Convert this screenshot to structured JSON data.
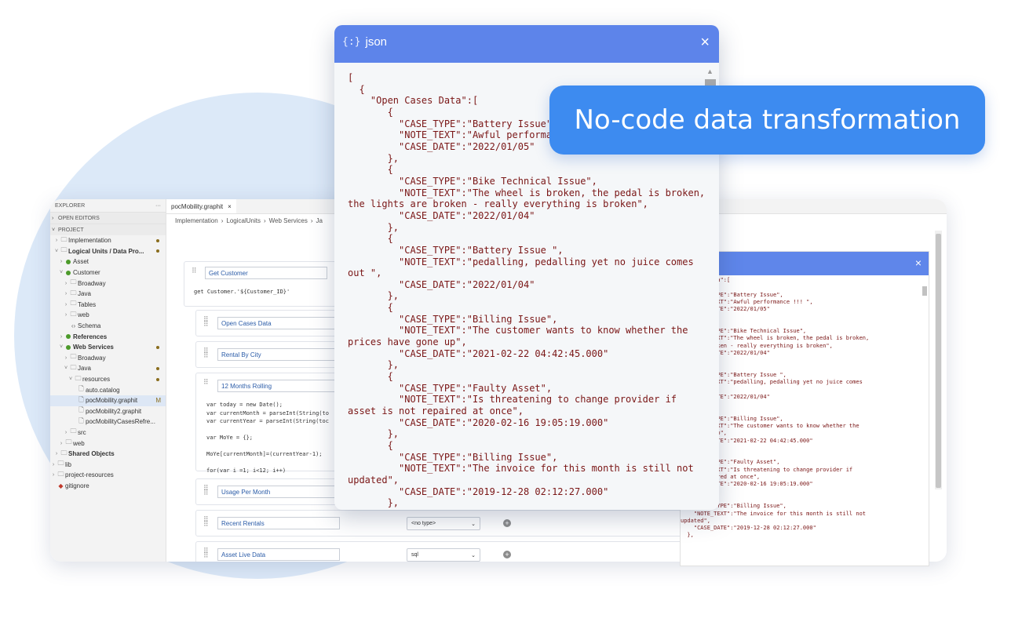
{
  "badge": {
    "text": "No-code data transformation"
  },
  "explorer": {
    "title": "EXPLORER",
    "more": "···",
    "open_editors": "OPEN EDITORS",
    "project": "PROJECT",
    "items": [
      {
        "label": "Implementation"
      },
      {
        "label": "Logical Units / Data Pro..."
      },
      {
        "label": "Asset"
      },
      {
        "label": "Customer"
      },
      {
        "label": "Broadway"
      },
      {
        "label": "Java"
      },
      {
        "label": "Tables"
      },
      {
        "label": "web"
      },
      {
        "label": "Schema"
      },
      {
        "label": "References"
      },
      {
        "label": "Web Services"
      },
      {
        "label": "Broadway"
      },
      {
        "label": "Java"
      },
      {
        "label": "resources"
      },
      {
        "label": "auto.catalog"
      },
      {
        "label": "pocMobility.graphit",
        "flag": "M"
      },
      {
        "label": "pocMobility2.graphit"
      },
      {
        "label": "pocMobilityCasesRefre..."
      },
      {
        "label": "src"
      },
      {
        "label": "web"
      },
      {
        "label": "Shared Objects"
      },
      {
        "label": "lib"
      },
      {
        "label": "project-resources"
      },
      {
        "label": "gitignore"
      }
    ]
  },
  "editor": {
    "tab": "pocMobility.graphit",
    "tab_close": "×",
    "breadcrumb": [
      "Implementation",
      "LogicalUnits",
      "Web Services",
      "Ja"
    ],
    "nodes": {
      "get_customer": "Get Customer",
      "get_customer_code": "get Customer.'${Customer_ID}'",
      "open_cases": "Open Cases Data",
      "rental_by_city": "Rental By City",
      "months_rolling": "12 Months Rolling",
      "months_code": "var today = new Date();\nvar currentMonth = parseInt(String(to\nvar currentYear = parseInt(String(toc\n\nvar MoYe = {};\n\nMoYe[currentMonth]=(currentYear-1);\n\nfor(var i =1; i<12; i++)",
      "usage_per_month": "Usage Per Month",
      "recent_rentals": "Recent Rentals",
      "recent_rentals_type": "<no type>",
      "asset_live": "Asset Live Data",
      "asset_live_type": "sql"
    }
  },
  "json_modal": {
    "title_icon": "{:}",
    "title": "json",
    "close": "×",
    "content": "[\n  {\n    \"Open Cases Data\":[\n       {\n         \"CASE_TYPE\":\"Battery Issue\",\n         \"NOTE_TEXT\":\"Awful performance !!! \",\n         \"CASE_DATE\":\"2022/01/05\"\n       },\n       {\n         \"CASE_TYPE\":\"Bike Technical Issue\",\n         \"NOTE_TEXT\":\"The wheel is broken, the pedal is broken,\nthe lights are broken - really everything is broken\",\n         \"CASE_DATE\":\"2022/01/04\"\n       },\n       {\n         \"CASE_TYPE\":\"Battery Issue \",\n         \"NOTE_TEXT\":\"pedalling, pedalling yet no juice comes\nout \",\n         \"CASE_DATE\":\"2022/01/04\"\n       },\n       {\n         \"CASE_TYPE\":\"Billing Issue\",\n         \"NOTE_TEXT\":\"The customer wants to know whether the\nprices have gone up\",\n         \"CASE_DATE\":\"2021-02-22 04:42:45.000\"\n       },\n       {\n         \"CASE_TYPE\":\"Faulty Asset\",\n         \"NOTE_TEXT\":\"Is threatening to change provider if\nasset is not repaired at once\",\n         \"CASE_DATE\":\"2020-02-16 19:05:19.000\"\n       },\n       {\n         \"CASE_TYPE\":\"Billing Issue\",\n         \"NOTE_TEXT\":\"The invoice for this month is still not\nupdated\",\n         \"CASE_DATE\":\"2019-12-28 02:12:27.000\"\n       },"
  },
  "json_panel": {
    "close": "×",
    "content": "  Cases Data\":[\n\n   \"CASE_TYPE\":\"Battery Issue\",\n   \"NOTE_TEXT\":\"Awful performance !!! \",\n   \"CASE_DATE\":\"2022/01/05\"\n\n\n   \"CASE_TYPE\":\"Bike Technical Issue\",\n   \"NOTE_TEXT\":\"The wheel is broken, the pedal is broken,\n  s are broken - really everything is broken\",\n   \"CASE_DATE\":\"2022/01/04\"\n\n\n   \"CASE_TYPE\":\"Battery Issue \",\n   \"NOTE_TEXT\":\"pedalling, pedalling yet no juice comes\n\n   \"CASE_DATE\":\"2022/01/04\"\n\n\n   \"CASE_TYPE\":\"Billing Issue\",\n   \"NOTE_TEXT\":\"The customer wants to know whether the\n  ve gone up\",\n   \"CASE_DATE\":\"2021-02-22 04:42:45.000\"\n\n\n   \"CASE_TYPE\":\"Faulty Asset\",\n   \"NOTE_TEXT\":\"Is threatening to change provider if\n  not repaired at once\",\n   \"CASE_DATE\":\"2020-02-16 19:05:19.000\"\n  },\n  {\n    \"CASE_TYPE\":\"Billing Issue\",\n    \"NOTE_TEXT\":\"The invoice for this month is still not\nupdated\",\n    \"CASE_DATE\":\"2019-12-28 02:12:27.000\"\n  },"
  }
}
